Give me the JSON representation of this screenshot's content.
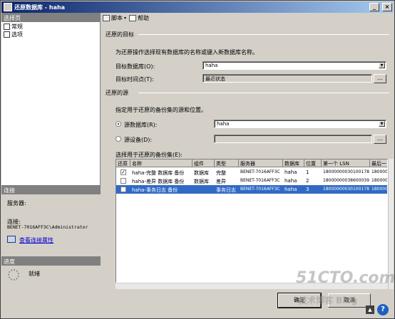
{
  "window": {
    "title": "还原数据库 - haha",
    "min": "_",
    "max": "□",
    "close": "×"
  },
  "left": {
    "select_page_header": "选择页",
    "nav": [
      {
        "label": "常规"
      },
      {
        "label": "选项"
      }
    ],
    "connection_header": "连接",
    "server_label": "服务器:",
    "server_value": "",
    "connection_label": "连接:",
    "connection_value": "BENET-7016AFF3C\\Administrator",
    "view_props_link": "查看连接属性",
    "progress_header": "进度",
    "progress_status": "就绪"
  },
  "toolbar": {
    "script_label": "脚本",
    "help_label": "帮助"
  },
  "destination": {
    "group_label": "还原的目标",
    "description": "为还原操作选择现有数据库的名称或键入新数据库名称。",
    "target_db_label": "目标数据库(O):",
    "target_db_value": "haha",
    "target_time_label": "目标时间点(T):",
    "target_time_value": "最近状态",
    "browse_label": "..."
  },
  "source": {
    "group_label": "还原的源",
    "description": "指定用于还原的备份集的源和位置。",
    "from_db_label": "源数据库(R):",
    "from_db_value": "haha",
    "from_device_label": "源设备(D):",
    "from_device_value": "",
    "browse_label": "..."
  },
  "backup_sets": {
    "label": "选择用于还原的备份集(E):",
    "columns": [
      "还原",
      "名称",
      "组件",
      "类型",
      "服务器",
      "数据库",
      "位置",
      "第一个 LSN",
      "最后一"
    ],
    "rows": [
      {
        "checked": true,
        "cells": [
          "haha-完整 数据库 备份",
          "数据库",
          "完整",
          "BENET-7016AFF3C",
          "haha",
          "1",
          "18000000030100178",
          "180000"
        ]
      },
      {
        "checked": false,
        "cells": [
          "haha-差异 数据库 备份",
          "数据库",
          "差异",
          "BENET-7016AFF3C",
          "haha",
          "2",
          "18000000038600039",
          "180000"
        ]
      },
      {
        "checked": false,
        "cells": [
          "haha-事务日志  备份",
          "",
          "事务日志",
          "BENET-7016AFF3C",
          "haha",
          "3",
          "18000000030100178",
          "180000"
        ]
      }
    ]
  },
  "buttons": {
    "ok": "确定",
    "cancel": "取消"
  },
  "watermark": {
    "line1": "51CTO.com",
    "line2": "技术博客   Blog"
  },
  "colors": {
    "title_start": "#0a246a",
    "title_end": "#a6caf0",
    "selection": "#316ac5"
  }
}
